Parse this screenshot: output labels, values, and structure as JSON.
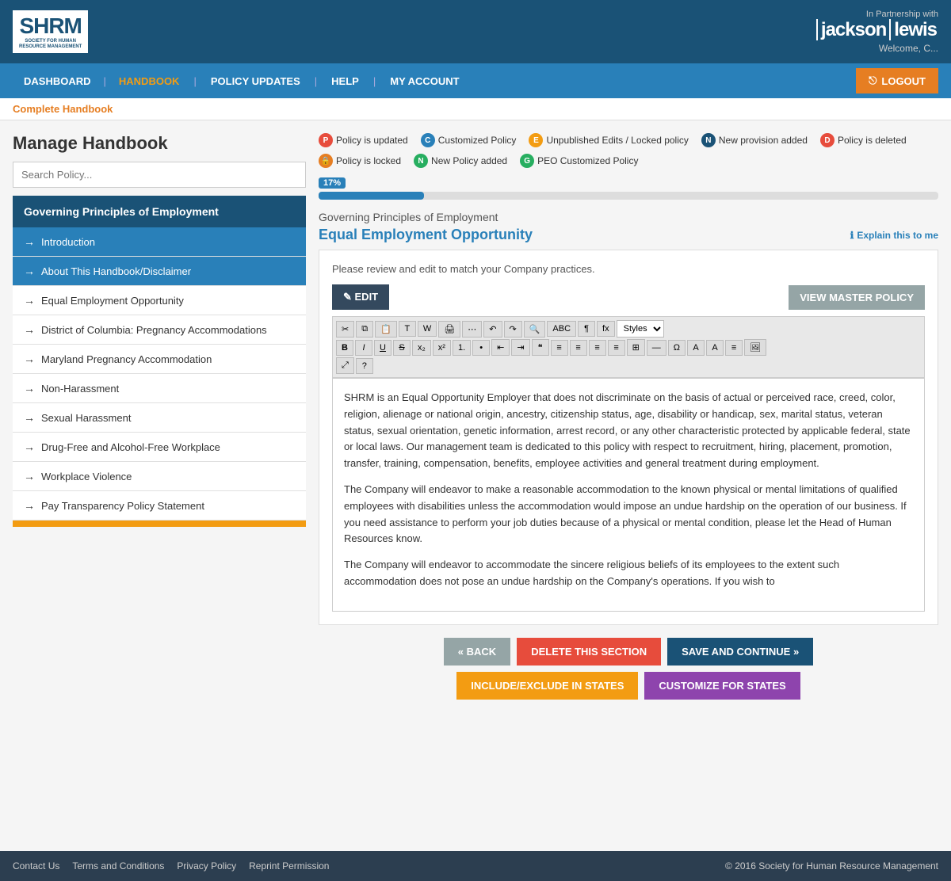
{
  "header": {
    "logo_letters": "SHRM",
    "logo_sub_line1": "SOCIETY FOR HUMAN",
    "logo_sub_line2": "RESOURCE MANAGEMENT",
    "partner_prefix": "In Partnership with",
    "partner_name1": "jackson",
    "partner_name2": "lewis",
    "welcome": "Welcome, C..."
  },
  "nav": {
    "items": [
      {
        "label": "DASHBOARD",
        "id": "dashboard",
        "active": false
      },
      {
        "label": "HANDBOOK",
        "id": "handbook",
        "active": true
      },
      {
        "label": "POLICY UPDATES",
        "id": "policy-updates",
        "active": false
      },
      {
        "label": "HELP",
        "id": "help",
        "active": false
      },
      {
        "label": "MY ACCOUNT",
        "id": "my-account",
        "active": false
      }
    ],
    "logout_label": "LOGOUT"
  },
  "breadcrumb": "Complete Handbook",
  "page_title": "Manage Handbook",
  "search_placeholder": "Search Policy...",
  "legend": {
    "items": [
      {
        "badge": "P",
        "badge_class": "badge-p",
        "label": "Policy is updated"
      },
      {
        "badge": "C",
        "badge_class": "badge-c",
        "label": "Customized Policy"
      },
      {
        "badge": "E",
        "badge_class": "badge-e",
        "label": "Unpublished Edits / Locked policy"
      },
      {
        "badge": "N",
        "badge_class": "badge-n",
        "label": "New provision added"
      },
      {
        "badge": "D",
        "badge_class": "badge-d",
        "label": "Policy is deleted"
      },
      {
        "badge": "🔒",
        "badge_class": "badge-lock",
        "label": "Policy is locked"
      },
      {
        "badge": "N",
        "badge_class": "badge-n2",
        "label": "New Policy added"
      },
      {
        "badge": "G",
        "badge_class": "badge-g",
        "label": "PEO Customized Policy"
      }
    ]
  },
  "progress": {
    "value": 17,
    "label": "17%"
  },
  "section_breadcrumb": "Governing Principles of Employment",
  "section_heading": "Equal Employment Opportunity",
  "explain_link": "Explain this to me",
  "editor": {
    "notice": "Please review and edit to match your Company practices.",
    "edit_label": "✎ EDIT",
    "view_master_label": "VIEW MASTER POLICY",
    "content_paragraphs": [
      "SHRM is an Equal Opportunity Employer that does not discriminate on the basis of actual or perceived race, creed, color, religion, alienage or national origin, ancestry, citizenship status, age, disability or handicap, sex, marital status, veteran status, sexual orientation, genetic information, arrest record, or any other characteristic protected by applicable federal, state or local laws. Our management team is dedicated to this policy with respect to recruitment, hiring, placement, promotion, transfer, training, compensation, benefits, employee activities and general treatment during employment.",
      "The Company will endeavor to make a reasonable accommodation to the known physical or mental limitations of qualified employees with disabilities unless the accommodation would impose an undue hardship on the operation of our business. If you need assistance to perform your job duties because of a physical or mental condition, please let the Head of Human Resources know.",
      "The Company will endeavor to accommodate the sincere religious beliefs of its employees to the extent such accommodation does not pose an undue hardship on the Company's operations. If you wish to"
    ]
  },
  "toolbar": {
    "row1": [
      "✂",
      "⧉",
      "⊞",
      "⊟",
      "⊠",
      "🖨",
      "⋯",
      "↶",
      "↷",
      "🔍",
      "✓✗",
      "≡",
      "fx"
    ],
    "styles_label": "Styles",
    "row2": [
      "B",
      "I",
      "U",
      "S",
      "x₂",
      "x²",
      "≡",
      "≡",
      "≡",
      "≡",
      "❝❞",
      "≡",
      "≡",
      "≡",
      "≡",
      "⊞",
      "—",
      "Ω"
    ],
    "row2b": [
      "A",
      "A",
      "≡",
      "🖼"
    ],
    "row3": [
      "⤢",
      "?"
    ]
  },
  "sidebar": {
    "group_title": "Governing Principles of Employment",
    "items": [
      {
        "label": "Introduction",
        "active": true,
        "id": "introduction"
      },
      {
        "label": "About This Handbook/Disclaimer",
        "active": true,
        "id": "about"
      },
      {
        "label": "Equal Employment Opportunity",
        "active": false,
        "id": "eeo"
      },
      {
        "label": "District of Columbia: Pregnancy Accommodations",
        "active": false,
        "id": "dc-pregnancy"
      },
      {
        "label": "Maryland Pregnancy Accommodation",
        "active": false,
        "id": "md-pregnancy"
      },
      {
        "label": "Non-Harassment",
        "active": false,
        "id": "non-harassment"
      },
      {
        "label": "Sexual Harassment",
        "active": false,
        "id": "sexual-harassment"
      },
      {
        "label": "Drug-Free and Alcohol-Free Workplace",
        "active": false,
        "id": "drug-free"
      },
      {
        "label": "Workplace Violence",
        "active": false,
        "id": "workplace-violence"
      },
      {
        "label": "Pay Transparency Policy Statement",
        "active": false,
        "id": "pay-transparency"
      }
    ]
  },
  "buttons": {
    "back": "« BACK",
    "delete": "DELETE THIS SECTION",
    "save": "SAVE AND CONTINUE »",
    "include": "INCLUDE/EXCLUDE IN STATES",
    "customize": "CUSTOMIZE FOR STATES"
  },
  "footer": {
    "links": [
      "Contact Us",
      "Terms and Conditions",
      "Privacy Policy",
      "Reprint Permission"
    ],
    "copyright": "© 2016 Society for Human Resource Management"
  }
}
